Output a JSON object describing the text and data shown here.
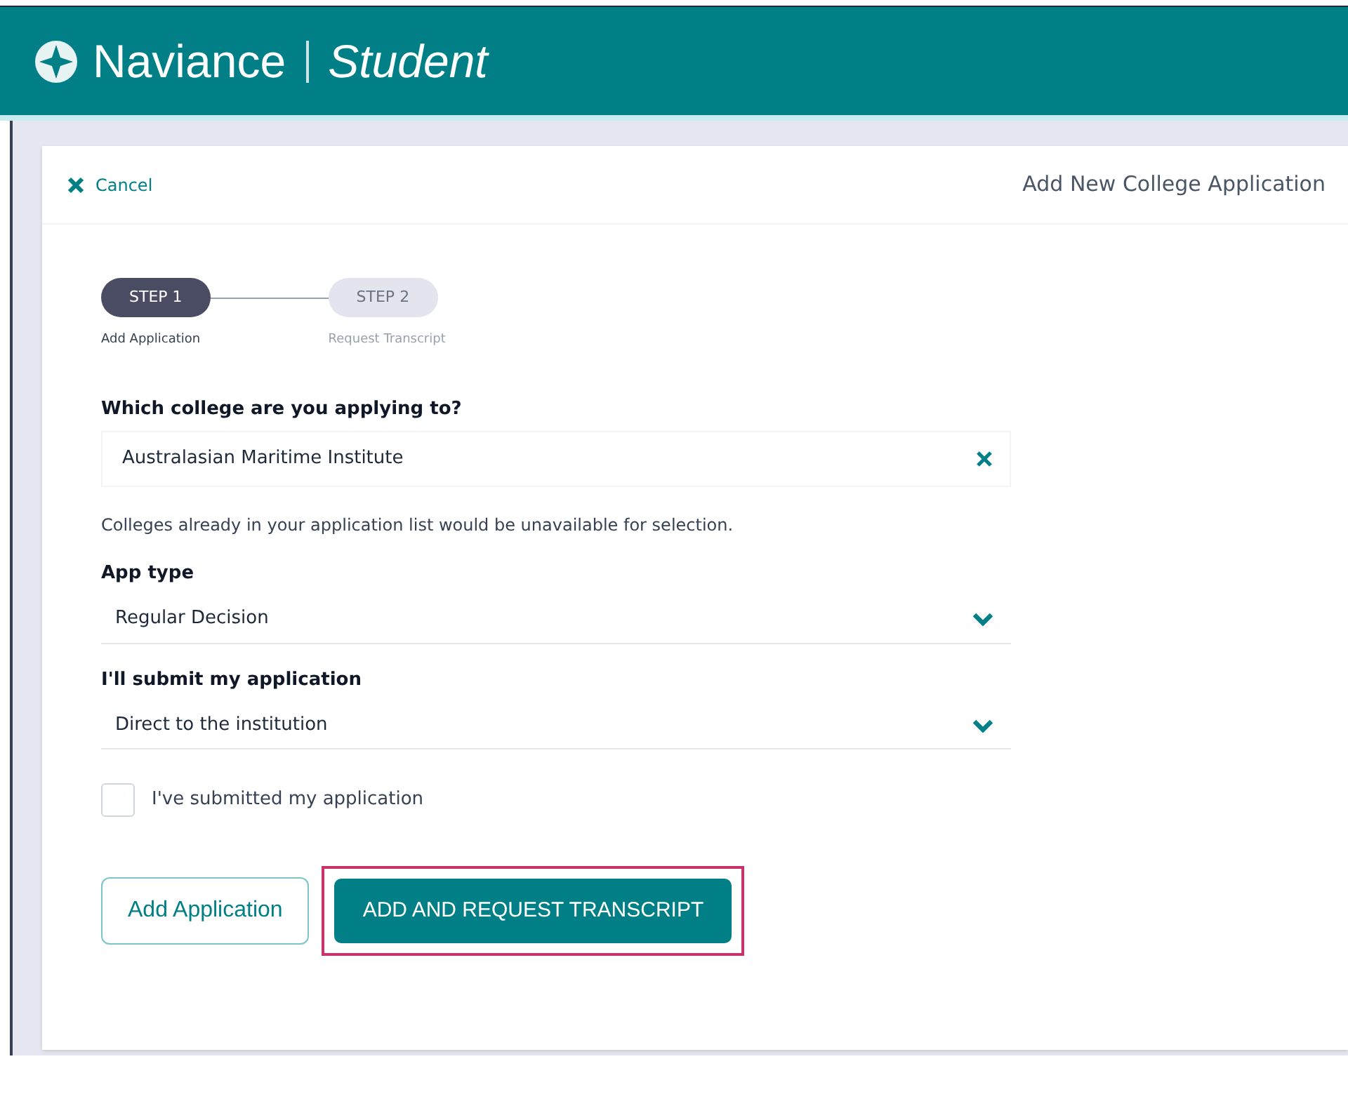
{
  "header": {
    "brand": "Naviance",
    "product": "Student"
  },
  "panel": {
    "cancel": "Cancel",
    "title": "Add New College Application"
  },
  "steps": [
    {
      "label": "STEP 1",
      "caption": "Add Application",
      "selected": true
    },
    {
      "label": "STEP 2",
      "caption": "Request Transcript",
      "selected": false
    }
  ],
  "fields": [
    {
      "kind": "search",
      "label": "Which college are you applying to?",
      "value": "Australasian Maritime Institute",
      "hint": "Colleges already in your application list would be unavailable for selection."
    },
    {
      "kind": "select",
      "label": "App type",
      "value": "Regular Decision"
    },
    {
      "kind": "select",
      "label": "I'll submit my application",
      "value": "Direct to the institution"
    }
  ],
  "checkbox": {
    "label": "I've submitted my application",
    "checked": false
  },
  "buttons": [
    {
      "kind": "outline",
      "label": "Add Application",
      "highlighted": false
    },
    {
      "kind": "primary",
      "label": "ADD AND REQUEST TRANSCRIPT",
      "highlighted": true
    }
  ]
}
